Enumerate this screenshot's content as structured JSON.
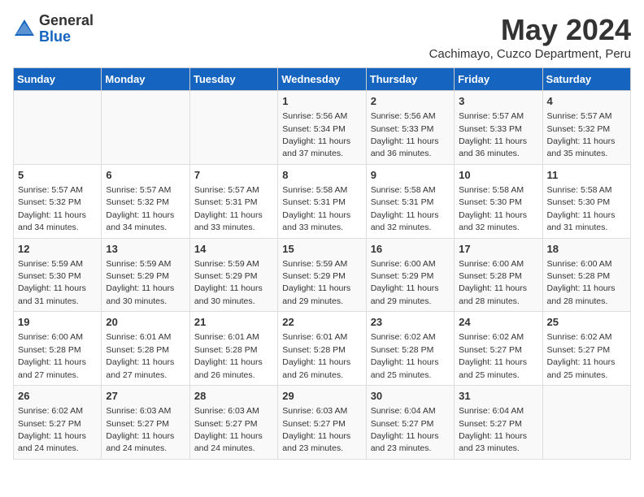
{
  "header": {
    "logo_general": "General",
    "logo_blue": "Blue",
    "month_year": "May 2024",
    "location": "Cachimayo, Cuzco Department, Peru"
  },
  "days_of_week": [
    "Sunday",
    "Monday",
    "Tuesday",
    "Wednesday",
    "Thursday",
    "Friday",
    "Saturday"
  ],
  "weeks": [
    [
      {
        "day": "",
        "detail": ""
      },
      {
        "day": "",
        "detail": ""
      },
      {
        "day": "",
        "detail": ""
      },
      {
        "day": "1",
        "detail": "Sunrise: 5:56 AM\nSunset: 5:34 PM\nDaylight: 11 hours and 37 minutes."
      },
      {
        "day": "2",
        "detail": "Sunrise: 5:56 AM\nSunset: 5:33 PM\nDaylight: 11 hours and 36 minutes."
      },
      {
        "day": "3",
        "detail": "Sunrise: 5:57 AM\nSunset: 5:33 PM\nDaylight: 11 hours and 36 minutes."
      },
      {
        "day": "4",
        "detail": "Sunrise: 5:57 AM\nSunset: 5:32 PM\nDaylight: 11 hours and 35 minutes."
      }
    ],
    [
      {
        "day": "5",
        "detail": "Sunrise: 5:57 AM\nSunset: 5:32 PM\nDaylight: 11 hours and 34 minutes."
      },
      {
        "day": "6",
        "detail": "Sunrise: 5:57 AM\nSunset: 5:32 PM\nDaylight: 11 hours and 34 minutes."
      },
      {
        "day": "7",
        "detail": "Sunrise: 5:57 AM\nSunset: 5:31 PM\nDaylight: 11 hours and 33 minutes."
      },
      {
        "day": "8",
        "detail": "Sunrise: 5:58 AM\nSunset: 5:31 PM\nDaylight: 11 hours and 33 minutes."
      },
      {
        "day": "9",
        "detail": "Sunrise: 5:58 AM\nSunset: 5:31 PM\nDaylight: 11 hours and 32 minutes."
      },
      {
        "day": "10",
        "detail": "Sunrise: 5:58 AM\nSunset: 5:30 PM\nDaylight: 11 hours and 32 minutes."
      },
      {
        "day": "11",
        "detail": "Sunrise: 5:58 AM\nSunset: 5:30 PM\nDaylight: 11 hours and 31 minutes."
      }
    ],
    [
      {
        "day": "12",
        "detail": "Sunrise: 5:59 AM\nSunset: 5:30 PM\nDaylight: 11 hours and 31 minutes."
      },
      {
        "day": "13",
        "detail": "Sunrise: 5:59 AM\nSunset: 5:29 PM\nDaylight: 11 hours and 30 minutes."
      },
      {
        "day": "14",
        "detail": "Sunrise: 5:59 AM\nSunset: 5:29 PM\nDaylight: 11 hours and 30 minutes."
      },
      {
        "day": "15",
        "detail": "Sunrise: 5:59 AM\nSunset: 5:29 PM\nDaylight: 11 hours and 29 minutes."
      },
      {
        "day": "16",
        "detail": "Sunrise: 6:00 AM\nSunset: 5:29 PM\nDaylight: 11 hours and 29 minutes."
      },
      {
        "day": "17",
        "detail": "Sunrise: 6:00 AM\nSunset: 5:28 PM\nDaylight: 11 hours and 28 minutes."
      },
      {
        "day": "18",
        "detail": "Sunrise: 6:00 AM\nSunset: 5:28 PM\nDaylight: 11 hours and 28 minutes."
      }
    ],
    [
      {
        "day": "19",
        "detail": "Sunrise: 6:00 AM\nSunset: 5:28 PM\nDaylight: 11 hours and 27 minutes."
      },
      {
        "day": "20",
        "detail": "Sunrise: 6:01 AM\nSunset: 5:28 PM\nDaylight: 11 hours and 27 minutes."
      },
      {
        "day": "21",
        "detail": "Sunrise: 6:01 AM\nSunset: 5:28 PM\nDaylight: 11 hours and 26 minutes."
      },
      {
        "day": "22",
        "detail": "Sunrise: 6:01 AM\nSunset: 5:28 PM\nDaylight: 11 hours and 26 minutes."
      },
      {
        "day": "23",
        "detail": "Sunrise: 6:02 AM\nSunset: 5:28 PM\nDaylight: 11 hours and 25 minutes."
      },
      {
        "day": "24",
        "detail": "Sunrise: 6:02 AM\nSunset: 5:27 PM\nDaylight: 11 hours and 25 minutes."
      },
      {
        "day": "25",
        "detail": "Sunrise: 6:02 AM\nSunset: 5:27 PM\nDaylight: 11 hours and 25 minutes."
      }
    ],
    [
      {
        "day": "26",
        "detail": "Sunrise: 6:02 AM\nSunset: 5:27 PM\nDaylight: 11 hours and 24 minutes."
      },
      {
        "day": "27",
        "detail": "Sunrise: 6:03 AM\nSunset: 5:27 PM\nDaylight: 11 hours and 24 minutes."
      },
      {
        "day": "28",
        "detail": "Sunrise: 6:03 AM\nSunset: 5:27 PM\nDaylight: 11 hours and 24 minutes."
      },
      {
        "day": "29",
        "detail": "Sunrise: 6:03 AM\nSunset: 5:27 PM\nDaylight: 11 hours and 23 minutes."
      },
      {
        "day": "30",
        "detail": "Sunrise: 6:04 AM\nSunset: 5:27 PM\nDaylight: 11 hours and 23 minutes."
      },
      {
        "day": "31",
        "detail": "Sunrise: 6:04 AM\nSunset: 5:27 PM\nDaylight: 11 hours and 23 minutes."
      },
      {
        "day": "",
        "detail": ""
      }
    ]
  ]
}
